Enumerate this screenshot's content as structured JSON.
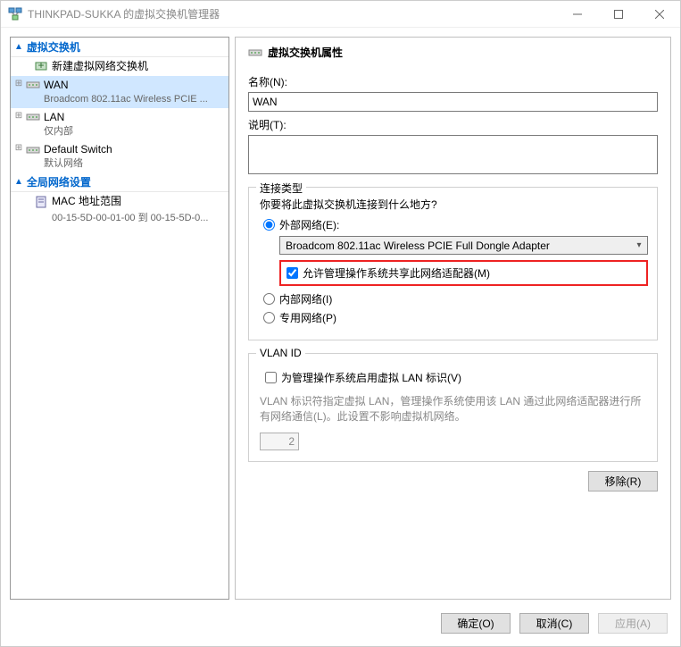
{
  "window": {
    "title": "THINKPAD-SUKKA 的虚拟交换机管理器"
  },
  "sidebar": {
    "sections": [
      {
        "title": "虚拟交换机",
        "items": [
          {
            "label": "新建虚拟网络交换机",
            "sub": ""
          },
          {
            "label": "WAN",
            "sub": "Broadcom 802.11ac Wireless PCIE ..."
          },
          {
            "label": "LAN",
            "sub": "仅内部"
          },
          {
            "label": "Default Switch",
            "sub": "默认网络"
          }
        ]
      },
      {
        "title": "全局网络设置",
        "items": [
          {
            "label": "MAC 地址范围",
            "sub": "00-15-5D-00-01-00 到 00-15-5D-0..."
          }
        ]
      }
    ]
  },
  "props": {
    "header": "虚拟交换机属性",
    "name_label": "名称(N):",
    "name_value": "WAN",
    "desc_label": "说明(T):",
    "desc_value": ""
  },
  "conn": {
    "legend": "连接类型",
    "prompt": "你要将此虚拟交换机连接到什么地方?",
    "external_label": "外部网络(E):",
    "adapter": "Broadcom 802.11ac Wireless PCIE Full Dongle Adapter",
    "share_label": "允许管理操作系统共享此网络适配器(M)",
    "internal_label": "内部网络(I)",
    "private_label": "专用网络(P)"
  },
  "vlan": {
    "legend": "VLAN ID",
    "enable_label": "为管理操作系统启用虚拟 LAN 标识(V)",
    "desc": "VLAN 标识符指定虚拟 LAN，管理操作系统使用该 LAN 通过此网络适配器进行所有网络通信(L)。此设置不影响虚拟机网络。",
    "value": "2"
  },
  "buttons": {
    "remove": "移除(R)",
    "ok": "确定(O)",
    "cancel": "取消(C)",
    "apply": "应用(A)"
  }
}
